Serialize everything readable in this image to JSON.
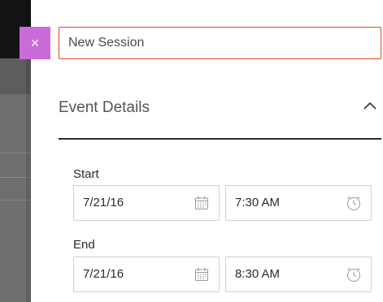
{
  "close": {
    "icon": "×"
  },
  "session": {
    "title_value": "New Session"
  },
  "section": {
    "title": "Event Details",
    "expanded": true
  },
  "start": {
    "label": "Start",
    "date": "7/21/16",
    "time": "7:30 AM"
  },
  "end": {
    "label": "End",
    "date": "7/21/16",
    "time": "8:30 AM"
  },
  "colors": {
    "accent": "#c96bd8",
    "error_border": "#e0442e",
    "rule": "#2b2b2b"
  },
  "icons": {
    "date": "calendar-icon",
    "time": "clock-icon",
    "collapse": "chevron-up-icon"
  }
}
